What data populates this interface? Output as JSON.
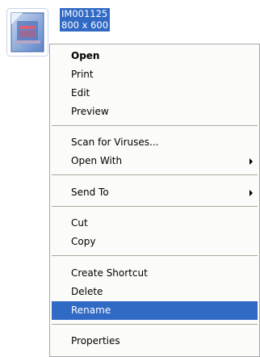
{
  "file": {
    "name": "IM001125",
    "dimensions": "800 x 600"
  },
  "menu": {
    "open": "Open",
    "print": "Print",
    "edit": "Edit",
    "preview": "Preview",
    "scan": "Scan for Viruses...",
    "open_with": "Open With",
    "send_to": "Send To",
    "cut": "Cut",
    "copy": "Copy",
    "create_shortcut": "Create Shortcut",
    "delete": "Delete",
    "rename": "Rename",
    "properties": "Properties"
  }
}
